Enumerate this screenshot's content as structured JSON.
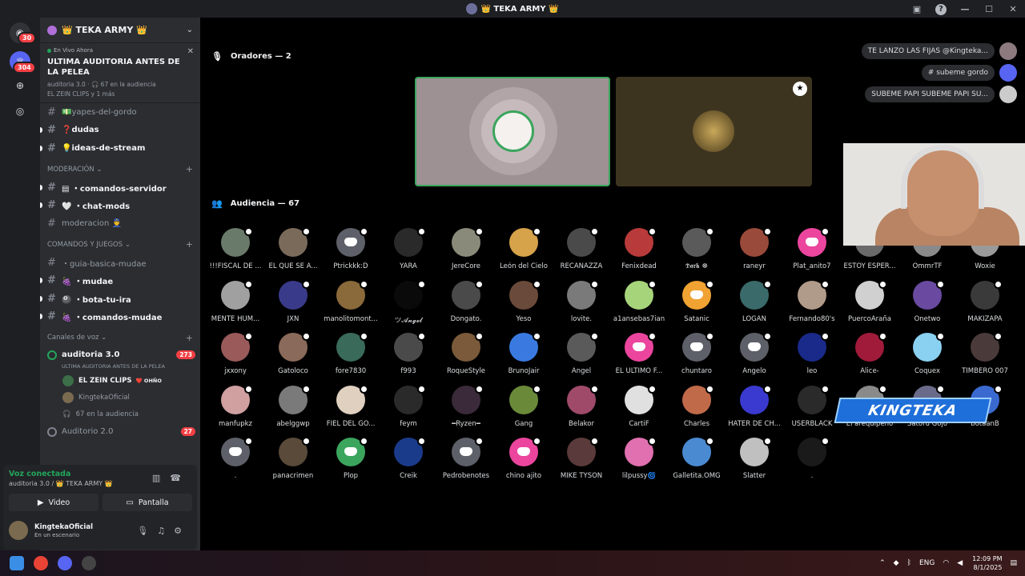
{
  "window": {
    "title": "👑 TEKA ARMY 👑"
  },
  "rail": {
    "dm_badge": "30",
    "server_badge": "304",
    "add_icon": "plus-icon",
    "explore_icon": "compass-icon"
  },
  "server": {
    "name": "👑 TEKA ARMY 👑"
  },
  "event": {
    "live_label": "En Vivo Ahora",
    "title": "ULTIMA AUDITORIA ANTES DE LA PELEA",
    "meta1": "auditoria 3.0 ·  🎧 67 en la audiencia",
    "meta2": "EL ZEIN CLIPS y 1 más"
  },
  "channels": [
    {
      "name": "💵yapes-del-gordo",
      "unread": false
    },
    {
      "name": "❓dudas",
      "unread": true
    },
    {
      "name": "💡ideas-de-stream",
      "unread": true
    }
  ],
  "cat_moderacion": "MODERACIÓN ⌄",
  "mod_channels": [
    {
      "name": "▤ ・comandos-servidor",
      "unread": true
    },
    {
      "name": "🤍 ・chat-mods",
      "unread": true
    },
    {
      "name": "moderacion 👮‍♂️",
      "unread": false
    }
  ],
  "cat_comandos": "COMANDOS Y JUEGOS ⌄",
  "game_channels": [
    {
      "name": "・guia-basica-mudae",
      "unread": false
    },
    {
      "name": "🍇 ・mudae",
      "unread": true
    },
    {
      "name": "🎱 ・bota-tu-ira",
      "unread": true
    },
    {
      "name": "🍇 ・comandos-mudae",
      "unread": true
    }
  ],
  "cat_voz": "Canales de voz ⌄",
  "voice": {
    "name": "auditoria 3.0",
    "badge": "273",
    "subtitle": "ULTIMA AUDITORIA ANTES DE LA PELEA",
    "users": [
      {
        "name": "EL ZEIN CLIPS",
        "tag": "❤️ OHÑO"
      },
      {
        "name": "KingtekaOficial",
        "tag": ""
      }
    ],
    "audience": "67 en la audiencia"
  },
  "voice2": {
    "name": "Auditorio 2.0",
    "badge": "27"
  },
  "panel": {
    "status": "Voz conectada",
    "sub": "auditoria 3.0 / 👑 TEKA ARMY 👑",
    "video": "Video",
    "screen": "Pantalla",
    "user": "KingtekaOficial",
    "user_status": "En un escenario"
  },
  "stage": {
    "speakers_title": "Oradores — 2",
    "audience_title": "Audiencia — 67"
  },
  "bubbles": [
    "TE LANZO LAS FIJAS @Kingteka...",
    "# subeme gordo",
    "SUBEME PAPI SUBEME PAPI SU..."
  ],
  "overlay": "KINGTEKA",
  "audience": [
    [
      "!!!FISCAL DE ...",
      "EL QUE SE A...",
      "Ptrickkk:D",
      "YARA",
      "JereCore",
      "León del Cielo",
      "RECANAZZA",
      "Fenixdead",
      "𝕯𝖆𝖗𝖐 ☸",
      "raneyr",
      "Plat_anito7",
      "ESTOY ESPER...",
      "OmmrTF",
      "Woxie"
    ],
    [
      "MENTE HUM...",
      "JXN",
      "manolitomont...",
      "ツ𝓐𝓷𝓰𝓮𝓵",
      "Dongato.",
      "Yeso",
      "lovite.",
      "a1ansebas7ian",
      "Satanic",
      "LOGAN",
      "Fernando80's",
      "PuercoAraña",
      "Onetwo",
      "MAKIZAPA"
    ],
    [
      "jxxony",
      "Gatoloco",
      "fore7830",
      "f993",
      "RoqueStyle",
      "BrunoJair",
      "Angel",
      "EL ÚLTIMO F...",
      "chuntaro",
      "Angelo",
      "leo",
      "Alice-",
      "Coquex",
      "TIMBERO 007"
    ],
    [
      "manfupkz",
      "abelggwp",
      "FIEL DEL GO...",
      "feym",
      "━Ryzen━",
      "Gang",
      "Belakor",
      "CartiF",
      "Charles",
      "HATER DE CH...",
      "USERBLACK",
      "El arequipeño",
      "Satoru Gojo",
      "botaanB"
    ],
    [
      ".",
      "panacrimen",
      "Plop",
      "Creik",
      "Pedrobenotes",
      "chino ajito",
      "MIKE TYSON",
      "lilpussy🌀",
      "Galletita.OMG",
      "Slatter",
      "."
    ]
  ],
  "taskbar": {
    "lang": "ENG",
    "time": "12:09 PM",
    "date": "8/1/2025"
  },
  "colors": {
    "accent": "#5865f2",
    "live": "#23a55a",
    "badge": "#f23f43"
  }
}
